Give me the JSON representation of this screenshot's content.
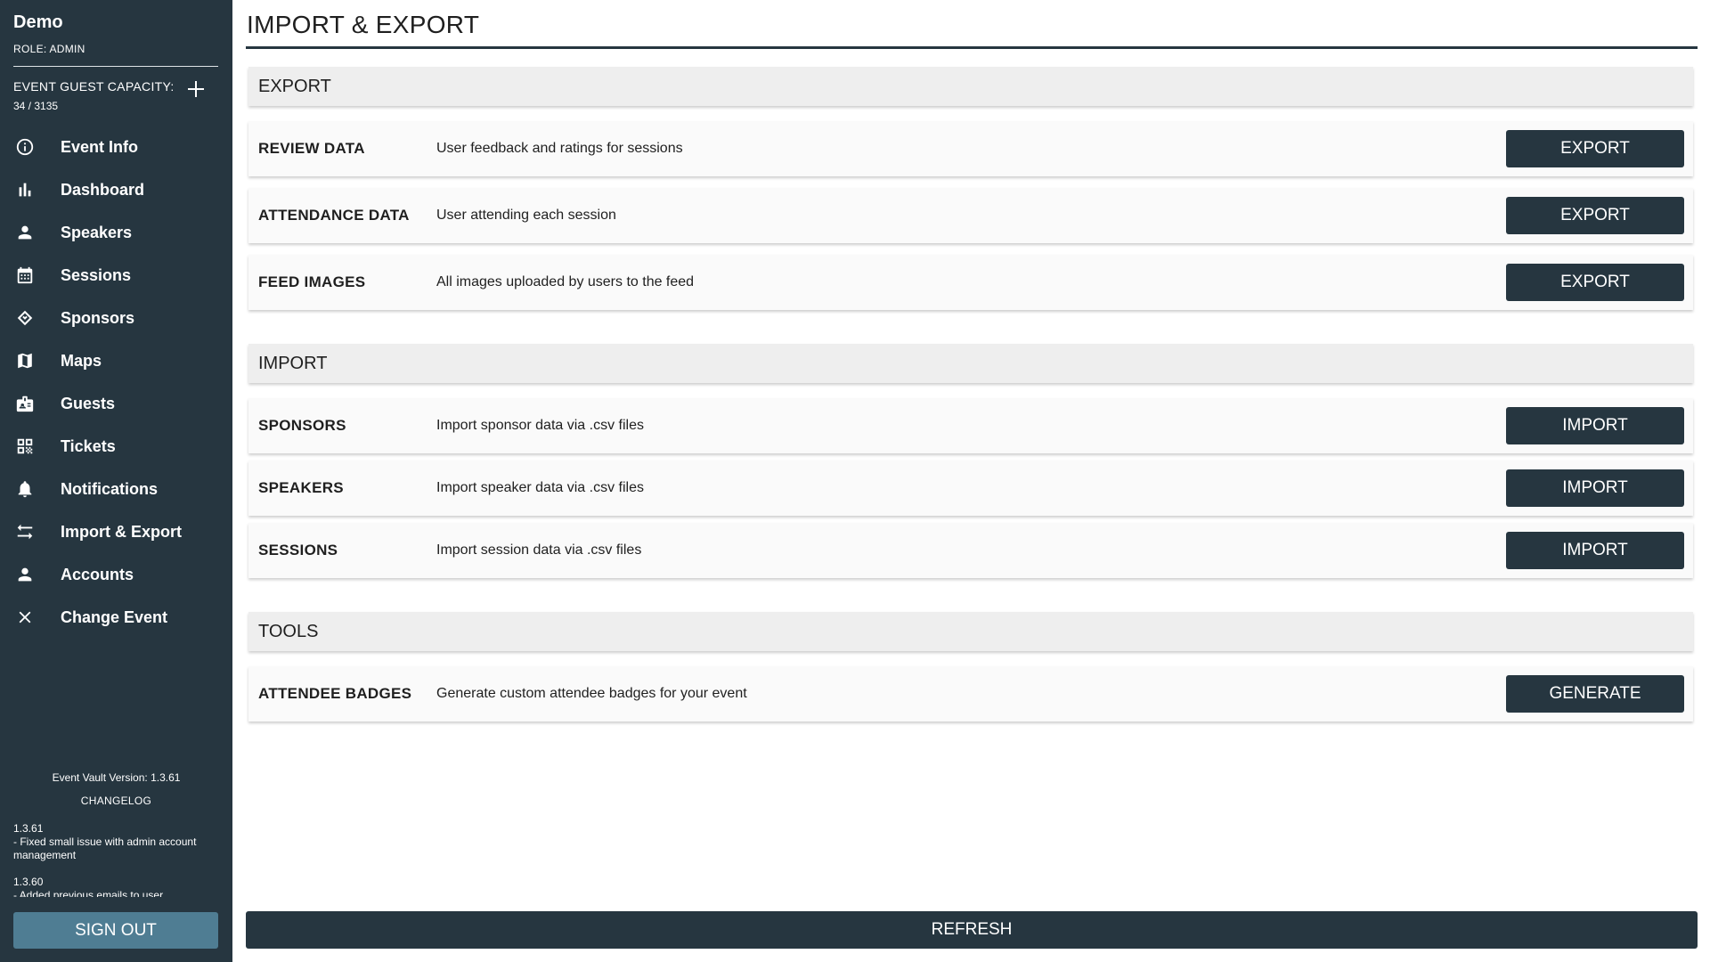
{
  "sidebar": {
    "event_name": "Demo",
    "role": "ROLE: ADMIN",
    "capacity_label": "EVENT GUEST CAPACITY:",
    "capacity_value": "34 / 3135",
    "nav": [
      {
        "label": "Event Info",
        "icon": "info-icon"
      },
      {
        "label": "Dashboard",
        "icon": "bar-chart-icon"
      },
      {
        "label": "Speakers",
        "icon": "person-icon"
      },
      {
        "label": "Sessions",
        "icon": "calendar-icon"
      },
      {
        "label": "Sponsors",
        "icon": "handshake-icon"
      },
      {
        "label": "Maps",
        "icon": "map-icon"
      },
      {
        "label": "Guests",
        "icon": "badge-icon"
      },
      {
        "label": "Tickets",
        "icon": "qr-code-icon"
      },
      {
        "label": "Notifications",
        "icon": "bell-icon"
      },
      {
        "label": "Import & Export",
        "icon": "swap-arrows-icon"
      },
      {
        "label": "Accounts",
        "icon": "person-icon"
      },
      {
        "label": "Change Event",
        "icon": "close-icon"
      }
    ],
    "version": "Event Vault Version: 1.3.61",
    "changelog_title": "CHANGELOG",
    "changelog": [
      {
        "version": "1.3.61",
        "note": "- Fixed small issue with admin account management"
      },
      {
        "version": "1.3.60",
        "note": "- Added previous emails to user"
      }
    ],
    "sign_out": "SIGN OUT"
  },
  "main": {
    "title": "IMPORT & EXPORT",
    "sections": [
      {
        "title": "EXPORT",
        "rows": [
          {
            "label": "REVIEW DATA",
            "description": "User feedback and ratings for sessions",
            "button": "EXPORT"
          },
          {
            "label": "ATTENDANCE DATA",
            "description": "User attending each session",
            "button": "EXPORT"
          },
          {
            "label": "FEED IMAGES",
            "description": "All images uploaded by users to the feed",
            "button": "EXPORT"
          }
        ]
      },
      {
        "title": "IMPORT",
        "rows": [
          {
            "label": "SPONSORS",
            "description": "Import sponsor data via .csv files",
            "button": "IMPORT"
          },
          {
            "label": "SPEAKERS",
            "description": "Import speaker data via .csv files",
            "button": "IMPORT"
          },
          {
            "label": "SESSIONS",
            "description": "Import session data via .csv files",
            "button": "IMPORT"
          }
        ]
      },
      {
        "title": "TOOLS",
        "rows": [
          {
            "label": "ATTENDEE BADGES",
            "description": "Generate custom attendee badges for your event",
            "button": "GENERATE"
          }
        ]
      }
    ],
    "refresh": "REFRESH"
  },
  "colors": {
    "sidebar_bg": "#263640",
    "button_bg": "#263640",
    "signout_bg": "#4f7d93",
    "section_header_bg": "#eeeeee",
    "row_bg": "#fafafa"
  }
}
